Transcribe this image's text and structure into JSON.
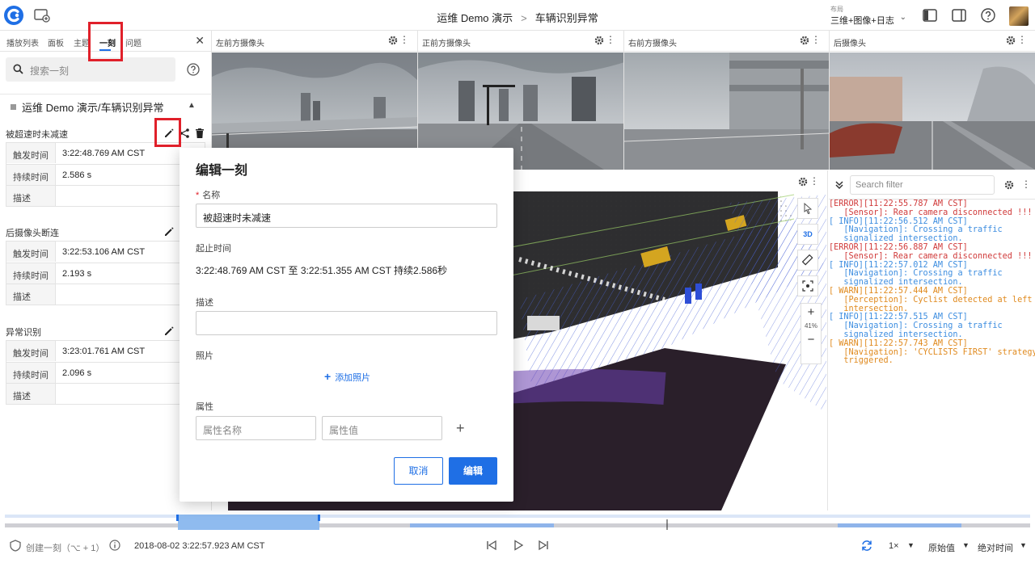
{
  "header": {
    "breadcrumb_project": "运维 Demo 演示",
    "breadcrumb_sep": ">",
    "breadcrumb_record": "车辆识别异常",
    "layout_caption": "布局",
    "layout_value": "三维+图像+日志"
  },
  "left_panel": {
    "tabs": [
      "播放列表",
      "面板",
      "主题",
      "一刻",
      "问题"
    ],
    "active_tab": "一刻",
    "search_placeholder": "搜索一刻",
    "project_title": "运维 Demo 演示/车辆识别异常",
    "moments": [
      {
        "name": "被超速时未减速",
        "rows": [
          {
            "k": "触发时间",
            "v": "3:22:48.769 AM CST"
          },
          {
            "k": "持续时间",
            "v": "2.586 s"
          },
          {
            "k": "描述",
            "v": ""
          }
        ]
      },
      {
        "name": "后摄像头断连",
        "rows": [
          {
            "k": "触发时间",
            "v": "3:22:53.106 AM CST"
          },
          {
            "k": "持续时间",
            "v": "2.193 s"
          },
          {
            "k": "描述",
            "v": ""
          }
        ]
      },
      {
        "name": "异常识别",
        "rows": [
          {
            "k": "触发时间",
            "v": "3:23:01.761 AM CST"
          },
          {
            "k": "持续时间",
            "v": "2.096 s"
          },
          {
            "k": "描述",
            "v": ""
          }
        ]
      }
    ]
  },
  "cameras": [
    "左前方摄像头",
    "正前方摄像头",
    "右前方摄像头",
    "后摄像头"
  ],
  "viewport": {
    "mode_3d": "3D",
    "zoom_in": "+",
    "zoom_out": "−",
    "zoom_pct": "41%"
  },
  "log_panel": {
    "filter_placeholder": "Search filter",
    "lines": [
      {
        "level": "err",
        "text": "[ERROR][11:22:55.787 AM CST]"
      },
      {
        "level": "err",
        "text": "   [Sensor]: Rear camera disconnected !!!"
      },
      {
        "level": "info",
        "text": "[ INFO][11:22:56.512 AM CST]"
      },
      {
        "level": "info",
        "text": "   [Navigation]: Crossing a traffic"
      },
      {
        "level": "info",
        "text": "   signalized intersection."
      },
      {
        "level": "err",
        "text": "[ERROR][11:22:56.887 AM CST]"
      },
      {
        "level": "err",
        "text": "   [Sensor]: Rear camera disconnected !!!"
      },
      {
        "level": "info",
        "text": "[ INFO][11:22:57.012 AM CST]"
      },
      {
        "level": "info",
        "text": "   [Navigation]: Crossing a traffic"
      },
      {
        "level": "info",
        "text": "   signalized intersection."
      },
      {
        "level": "warn",
        "text": "[ WARN][11:22:57.444 AM CST]"
      },
      {
        "level": "warn",
        "text": "   [Perception]: Cyclist detected at left"
      },
      {
        "level": "warn",
        "text": "   intersection."
      },
      {
        "level": "info",
        "text": "[ INFO][11:22:57.515 AM CST]"
      },
      {
        "level": "info",
        "text": "   [Navigation]: Crossing a traffic"
      },
      {
        "level": "info",
        "text": "   signalized intersection."
      },
      {
        "level": "warn",
        "text": "[ WARN][11:22:57.743 AM CST]"
      },
      {
        "level": "warn",
        "text": "   [Navigation]: 'CYCLISTS FIRST' strategy"
      },
      {
        "level": "warn",
        "text": "   triggered."
      }
    ]
  },
  "modal": {
    "title": "编辑一刻",
    "name_required_mark": "*",
    "name_label": "名称",
    "name_value": "被超速时未减速",
    "range_label": "起止时间",
    "range_value": "3:22:48.769 AM CST 至 3:22:51.355 AM CST 持续2.586秒",
    "desc_label": "描述",
    "desc_value": "",
    "photo_label": "照片",
    "add_photo": "添加照片",
    "attr_label": "属性",
    "attr_name_placeholder": "属性名称",
    "attr_value_placeholder": "属性值",
    "cancel": "取消",
    "submit": "编辑"
  },
  "bottom_bar": {
    "create_moment": "创建一刻（⌥ + 1）",
    "timestamp": "2018-08-02 3:22:57.923 AM CST",
    "speed": "1×",
    "value_mode": "原始值",
    "time_mode": "绝对时间"
  },
  "colors": {
    "accent": "#1f6fe5",
    "highlight": "#e0202a",
    "error": "#d03a3a",
    "info": "#3e8ee0",
    "warn": "#e08a1e"
  }
}
